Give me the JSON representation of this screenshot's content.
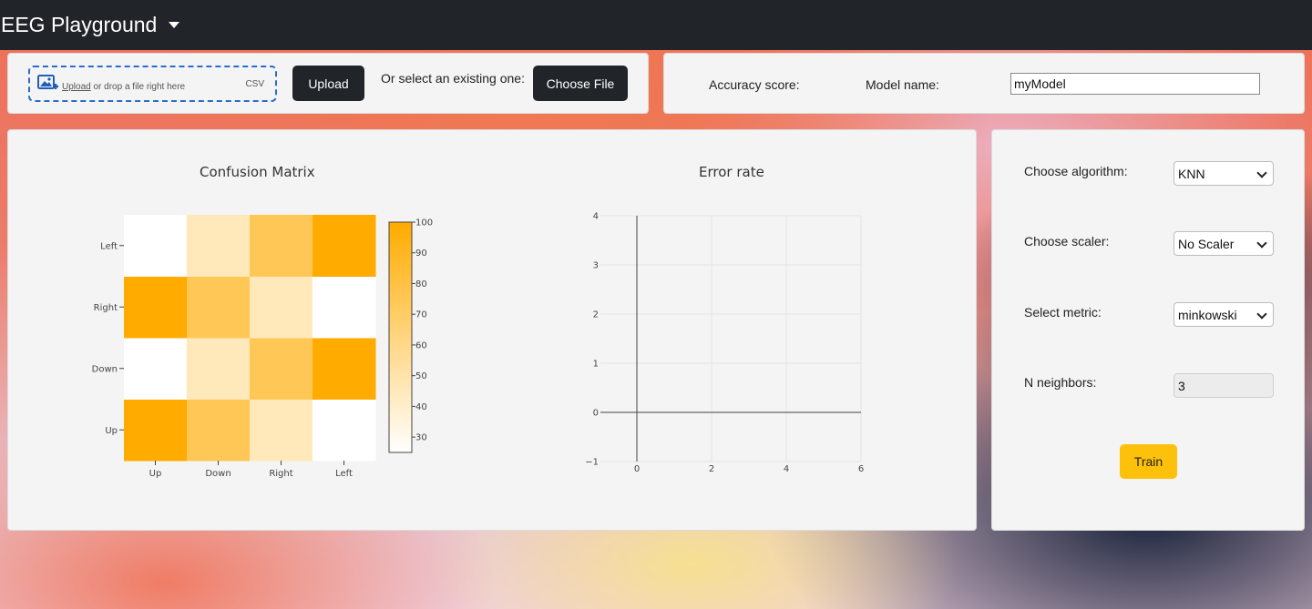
{
  "app": {
    "title": "EEG Playground"
  },
  "upload": {
    "link_text": "Upload",
    "drop_text": " or drop a file right here",
    "file_type": "CSV",
    "upload_button": "Upload",
    "or_select_text": "Or select an existing one:",
    "choose_file_button": "Choose File"
  },
  "model_info": {
    "accuracy_label": "Accuracy score:",
    "model_name_label": "Model name:",
    "model_name_value": "myModel"
  },
  "controls": {
    "algorithm_label": "Choose algorithm:",
    "algorithm_value": "KNN",
    "scaler_label": "Choose scaler:",
    "scaler_value": "No Scaler",
    "metric_label": "Select metric:",
    "metric_value": "minkowski",
    "neighbors_label": "N neighbors:",
    "neighbors_value": "3",
    "train_button": "Train"
  },
  "colors": {
    "navbar": "#212529",
    "heat_high": "#ffab00",
    "heat_low": "#ffffff",
    "train_button": "#fdc10c",
    "dropzone_border": "#2a6cc9"
  },
  "chart_data": [
    {
      "type": "heatmap",
      "title": "Confusion Matrix",
      "x_categories": [
        "Up",
        "Down",
        "Right",
        "Left"
      ],
      "y_categories": [
        "Up",
        "Down",
        "Right",
        "Left"
      ],
      "z": [
        [
          100,
          75,
          45,
          25
        ],
        [
          25,
          45,
          75,
          100
        ],
        [
          100,
          75,
          45,
          25
        ],
        [
          25,
          45,
          75,
          100
        ]
      ],
      "colorbar_ticks": [
        30,
        40,
        50,
        60,
        70,
        80,
        90,
        100
      ],
      "zrange": [
        25,
        100
      ]
    },
    {
      "type": "line",
      "title": "Error rate",
      "series": [],
      "xlim": [
        -1,
        6
      ],
      "ylim": [
        -1,
        4
      ],
      "x_ticks": [
        0,
        2,
        4,
        6
      ],
      "y_ticks": [
        -1,
        0,
        1,
        2,
        3,
        4
      ],
      "grid": true
    }
  ]
}
